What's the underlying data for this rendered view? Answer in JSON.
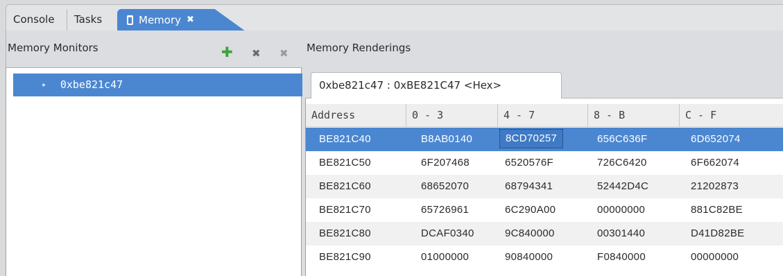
{
  "tabs": {
    "console": "Console",
    "tasks": "Tasks",
    "memory": "Memory",
    "close_glyph": "✖"
  },
  "monitors": {
    "title": "Memory Monitors",
    "items": [
      {
        "label": "0xbe821c47"
      }
    ],
    "icons": [
      "add-icon",
      "remove-icon",
      "remove-all-icon"
    ]
  },
  "renderings": {
    "title": "Memory Renderings",
    "tab_label": "0xbe821c47 : 0xBE821C47 <Hex>",
    "columns": [
      "Address",
      "0 - 3",
      "4 - 7",
      "8 - B",
      "C - F"
    ],
    "rows": [
      [
        "BE821C40",
        "B8AB0140",
        "8CD70257",
        "656C636F",
        "6D652074"
      ],
      [
        "BE821C50",
        "6F207468",
        "6520576F",
        "726C6420",
        "6F662074"
      ],
      [
        "BE821C60",
        "68652070",
        "68794341",
        "52442D4C",
        "21202873"
      ],
      [
        "BE821C70",
        "65726961",
        "6C290A00",
        "00000000",
        "881C82BE"
      ],
      [
        "BE821C80",
        "DCAF0340",
        "9C840000",
        "00301440",
        "D41D82BE"
      ],
      [
        "BE821C90",
        "01000000",
        "90840000",
        "F0840000",
        "00000000"
      ]
    ]
  },
  "colors": {
    "accent": "#4b87d1",
    "selected_text": "#ffffff"
  }
}
